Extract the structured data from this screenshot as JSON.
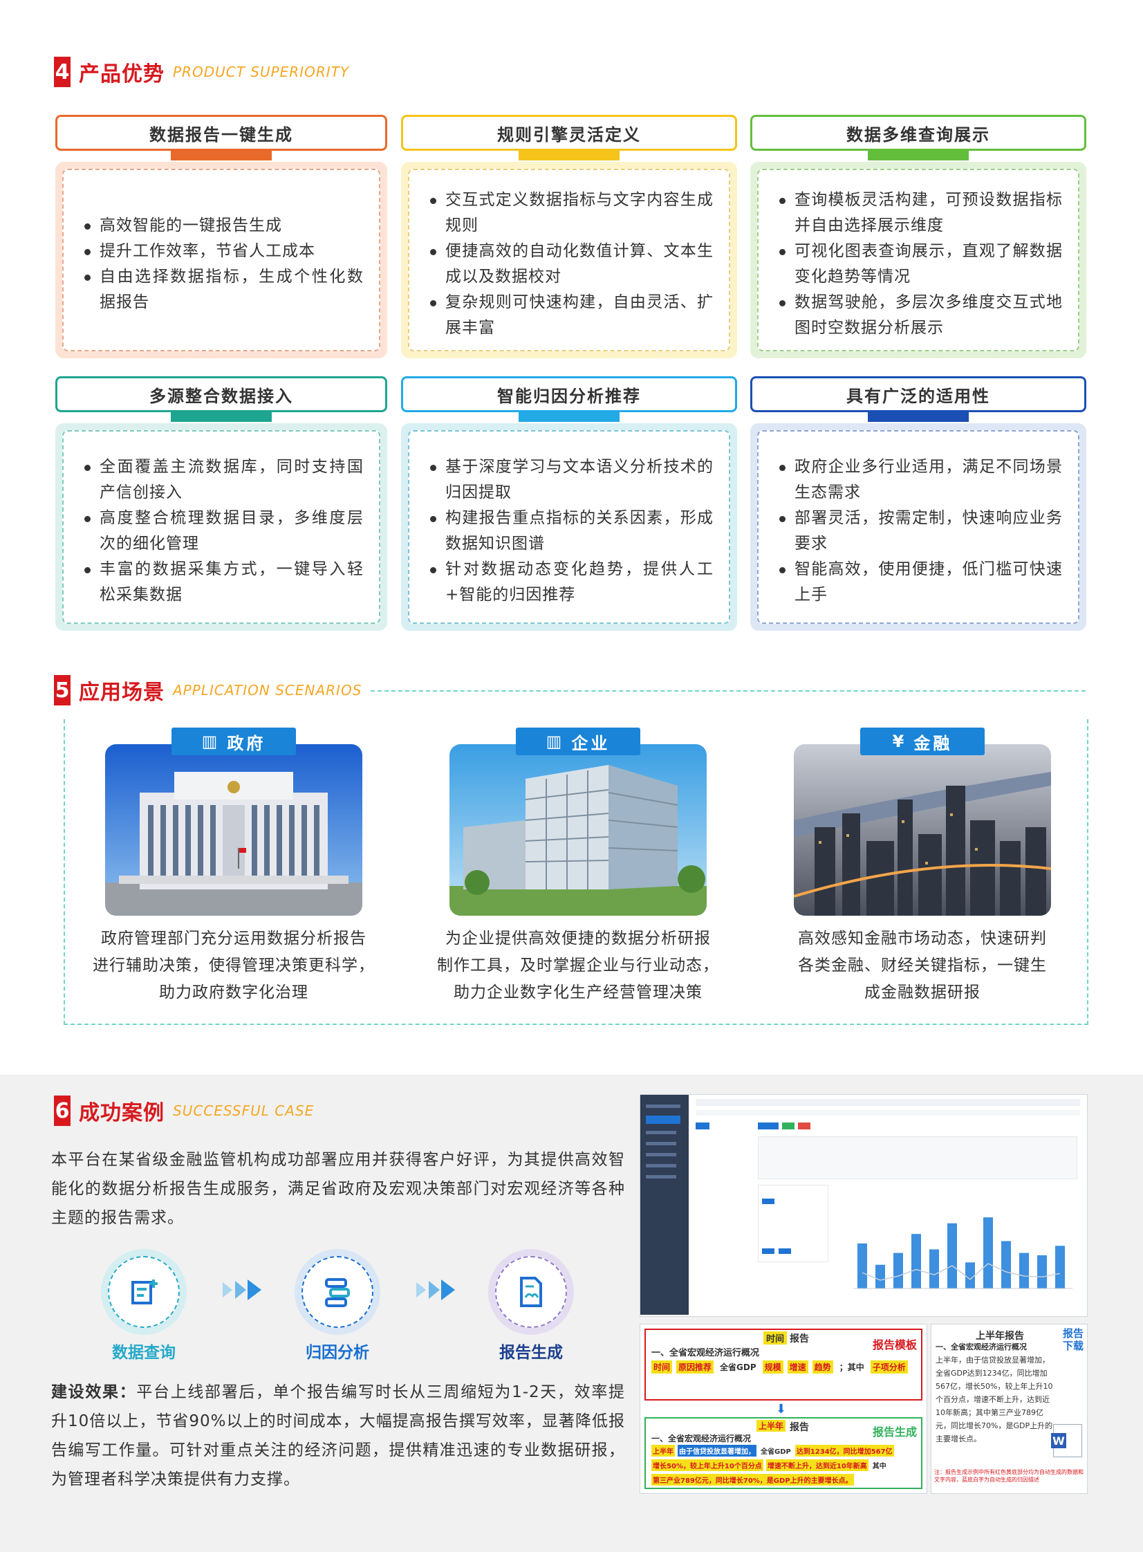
{
  "sections": {
    "s4": {
      "num": "4",
      "title": "产品优势",
      "en": "PRODUCT SUPERIORITY"
    },
    "s5": {
      "num": "5",
      "title": "应用场景",
      "en": "APPLICATION SCENARIOS"
    },
    "s6": {
      "num": "6",
      "title": "成功案例",
      "en": "SUCCESSFUL CASE"
    }
  },
  "features": [
    {
      "title": "数据报告一键生成",
      "color": "#e8692a",
      "items": [
        "高效智能的一键报告生成",
        "提升工作效率，节省人工成本",
        "自由选择数据指标，生成个性化数据报告"
      ]
    },
    {
      "title": "规则引擎灵活定义",
      "color": "#f6c31a",
      "items": [
        "交互式定义数据指标与文字内容生成规则",
        "便捷高效的自动化数值计算、文本生成以及数据校对",
        "复杂规则可快速构建，自由灵活、扩展丰富"
      ]
    },
    {
      "title": "数据多维查询展示",
      "color": "#63be3c",
      "items": [
        "查询模板灵活构建，可预设数据指标并自由选择展示维度",
        "可视化图表查询展示，直观了解数据变化趋势等情况",
        "数据驾驶舱，多层次多维度交互式地图时空数据分析展示"
      ]
    },
    {
      "title": "多源整合数据接入",
      "color": "#1ea58f",
      "items": [
        "全面覆盖主流数据库，同时支持国产信创接入",
        "高度整合梳理数据目录，多维度层次的细化管理",
        "丰富的数据采集方式，一键导入轻松采集数据"
      ]
    },
    {
      "title": "智能归因分析推荐",
      "color": "#22a9e6",
      "items": [
        "基于深度学习与文本语义分析技术的归因提取",
        "构建报告重点指标的关系因素，形成数据知识图谱",
        "针对数据动态变化趋势，提供人工+智能的归因推荐"
      ]
    },
    {
      "title": "具有广泛的适用性",
      "color": "#1b4fb3",
      "items": [
        "政府企业多行业适用，满足不同场景生态需求",
        "部署灵活，按需定制，快速响应业务要求",
        "智能高效，使用便捷，低门槛可快速上手"
      ]
    }
  ],
  "scenarios": [
    {
      "tag": "政府",
      "icon": "government-building-icon",
      "text": [
        "政府管理部门充分运用数据分析报告",
        "进行辅助决策，使得管理决策更科学，",
        "助力政府数字化治理"
      ]
    },
    {
      "tag": "企业",
      "icon": "enterprise-building-icon",
      "text": [
        "为企业提供高效便捷的数据分析研报",
        "制作工具，及时掌握企业与行业动态，",
        "助力企业数字化生产经营管理决策"
      ]
    },
    {
      "tag": "金融",
      "icon": "finance-yen-icon",
      "text": [
        "高效感知金融市场动态，快速研判",
        "各类金融、财经关键指标，一键生",
        "成金融数据研报"
      ]
    }
  ],
  "case": {
    "intro": "本平台在某省级金融监管机构成功部署应用并获得客户好评，为其提供高效智能化的数据分析报告生成服务，满足省政府及宏观决策部门对宏观经济等各种主题的报告需求。",
    "flow": [
      {
        "label": "数据查询",
        "color": "#27a9c9",
        "icon": "data-query-icon"
      },
      {
        "label": "归因分析",
        "color": "#1a6fd0",
        "icon": "attribution-analysis-icon"
      },
      {
        "label": "报告生成",
        "color": "#1c3f8f",
        "icon": "report-generation-icon"
      }
    ],
    "effect_label": "建设效果：",
    "effect_text": "平台上线部署后，单个报告编写时长从三周缩短为1-2天，效率提升10倍以上，节省90%以上的时间成本，大幅提高报告撰写效率，显著降低报告编写工作量。可针对重点关注的经济问题，提供精准迅速的专业数据研报，为管理者科学决策提供有力支撑。",
    "template": {
      "heading": "一、全省宏观经济运行概况",
      "time_tag": "时间",
      "report_word": "报告",
      "badge": "报告模板",
      "tags": [
        "时间",
        "原因推荐",
        "全省GDP",
        "规模",
        "增速",
        "趋势",
        "；其中",
        "子项分析"
      ]
    },
    "generated": {
      "heading": "一、全省宏观经济运行概况",
      "time_tag": "上半年",
      "report_word": "报告",
      "badge": "报告生成",
      "lines": [
        "上半年",
        "由于信贷投放显著增加，",
        "全省GDP",
        "达到1234亿，同比增加567亿",
        "增长50%，较上年上升10个百分点",
        "增速不断上升，达到近10年新高",
        "其中",
        "第三产业789亿元，同比增长70%，是GDP上升的主要增长点。"
      ]
    },
    "download": {
      "title": "上半年报告",
      "label": "报告下载",
      "heading": "一、全省宏观经济运行概况",
      "body": "上半年，由于信贷投放显著增加，全省GDP达到1234亿，同比增加567亿，增长50%，较上年上升10个百分点，增速不断上升，达到近10年新高；其中第三产业789亿元，同比增长70%，是GDP上升的主要增长点。",
      "note": "注：报告生成示例中所有红色黄底部分均为自动生成的数据和文字内容，蓝底白字为自动生成的归因描述"
    },
    "chart_data": {
      "type": "bar",
      "values": [
        38,
        20,
        30,
        46,
        33,
        55,
        22,
        60,
        40,
        30,
        28,
        36
      ]
    }
  }
}
